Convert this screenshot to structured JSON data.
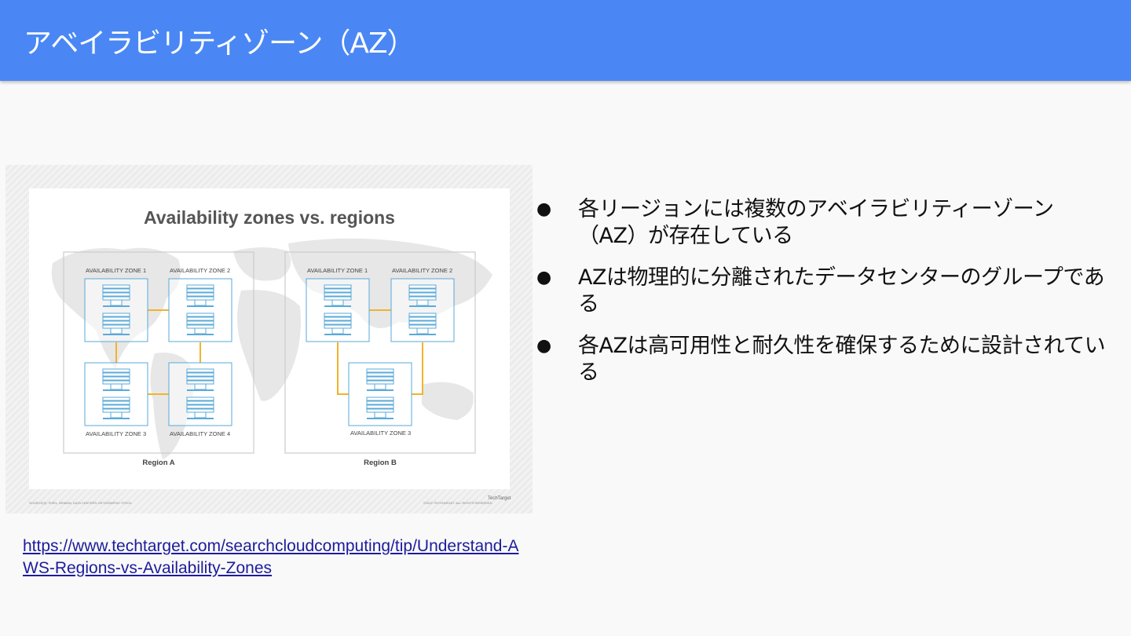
{
  "header": {
    "title": "アベイラビリティゾーン（AZ）"
  },
  "figure": {
    "title": "Availability zones vs. regions",
    "regions": [
      {
        "label": "Region A",
        "zones": [
          "AVAILABILITY ZONE 1",
          "AVAILABILITY ZONE 2",
          "AVAILABILITY ZONE 3",
          "AVAILABILITY ZONE 4"
        ]
      },
      {
        "label": "Region B",
        "zones": [
          "AVAILABILITY ZONE 1",
          "AVAILABILITY ZONE 2",
          "AVAILABILITY ZONE 3"
        ]
      }
    ],
    "source": "SOURCE(S): PIXEL, BRIMAN, DATA CENTERS: INFOGRAPHIC STOCK",
    "copyright": "©2022 TECHTARGET. ALL RIGHTS RESERVED",
    "logo": "TechTarget",
    "colors": {
      "zone_border": "#5aaad8",
      "link_line": "#f2b32a",
      "region_border": "#cccccc"
    }
  },
  "link": {
    "text": "https://www.techtarget.com/searchcloudcomputing/tip/Understand-AWS-Regions-vs-Availability-Zones"
  },
  "bullets": [
    {
      "marker": "●",
      "text": "各リージョンには複数のアベイラビリティーゾーン（AZ）が存在している"
    },
    {
      "marker": "●",
      "text": "AZは物理的に分離されたデータセンターのグループである"
    },
    {
      "marker": "●",
      "text": "各AZは高可用性と耐久性を確保するために設計されている"
    }
  ],
  "colors": {
    "header_bg": "#4a87f4",
    "page_bg": "#f9f9f9",
    "link": "#1c1c9c"
  }
}
